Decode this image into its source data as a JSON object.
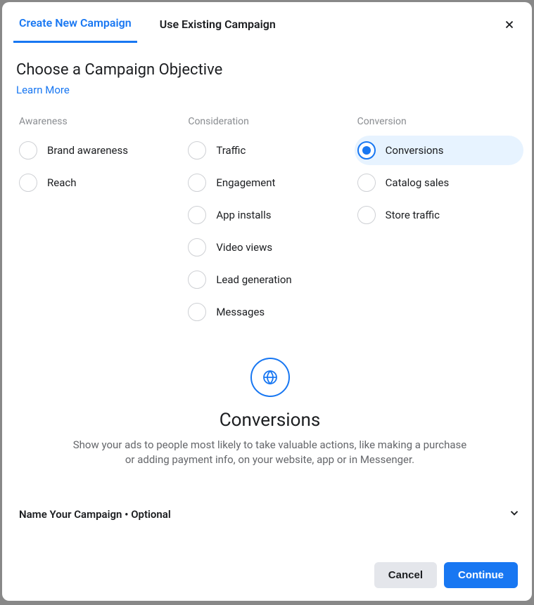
{
  "tabs": {
    "create_new": "Create New Campaign",
    "use_existing": "Use Existing Campaign"
  },
  "heading": "Choose a Campaign Objective",
  "learn_more": "Learn More",
  "columns": {
    "awareness": {
      "header": "Awareness",
      "items": [
        "Brand awareness",
        "Reach"
      ]
    },
    "consideration": {
      "header": "Consideration",
      "items": [
        "Traffic",
        "Engagement",
        "App installs",
        "Video views",
        "Lead generation",
        "Messages"
      ]
    },
    "conversion": {
      "header": "Conversion",
      "items": [
        "Conversions",
        "Catalog sales",
        "Store traffic"
      ]
    }
  },
  "detail": {
    "title": "Conversions",
    "description": "Show your ads to people most likely to take valuable actions, like making a purchase or adding payment info, on your website, app or in Messenger."
  },
  "name_campaign": "Name Your Campaign • Optional",
  "footer": {
    "cancel": "Cancel",
    "continue": "Continue"
  }
}
